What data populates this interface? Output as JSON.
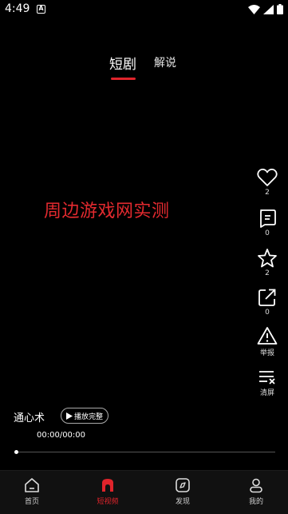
{
  "status_bar": {
    "time": "4:49",
    "notification_icon": "a-icon",
    "icons": [
      "wifi-icon",
      "signal-icon",
      "battery-icon"
    ]
  },
  "top_tabs": [
    {
      "label": "短剧",
      "active": true
    },
    {
      "label": "解说",
      "active": false
    }
  ],
  "watermark": "周边游戏网实测",
  "side_actions": {
    "like": {
      "icon": "heart-icon",
      "count": "2"
    },
    "comment": {
      "icon": "comment-icon",
      "count": "0"
    },
    "favorite": {
      "icon": "star-icon",
      "count": "2"
    },
    "share": {
      "icon": "share-icon",
      "count": "0"
    },
    "report": {
      "icon": "warning-icon",
      "label": "举报"
    },
    "clear": {
      "icon": "clear-screen-icon",
      "label": "清屏"
    }
  },
  "video": {
    "title": "通心术",
    "play_full_label": "播放完整",
    "time": "00:00/00:00",
    "progress": 0
  },
  "bottom_nav": [
    {
      "label": "首页",
      "icon": "home-icon",
      "active": false
    },
    {
      "label": "短视频",
      "icon": "short-video-icon",
      "active": true
    },
    {
      "label": "发现",
      "icon": "discover-icon",
      "active": false
    },
    {
      "label": "我的",
      "icon": "profile-icon",
      "active": false
    }
  ],
  "colors": {
    "accent": "#e0242b",
    "watermark": "#e32a2f",
    "background": "#000000"
  }
}
